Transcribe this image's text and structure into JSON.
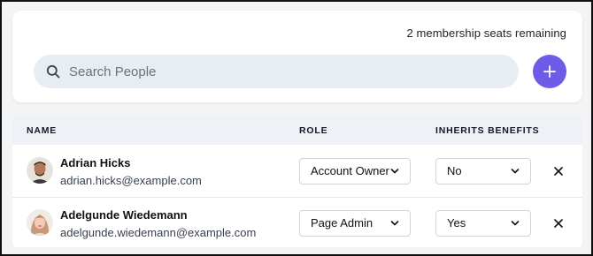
{
  "header": {
    "seats_text": "2 membership seats remaining"
  },
  "search": {
    "placeholder": "Search People",
    "value": ""
  },
  "add_button": {
    "icon": "plus-icon",
    "color": "#6d5ce7"
  },
  "table": {
    "columns": [
      "NAME",
      "ROLE",
      "INHERITS BENEFITS"
    ],
    "rows": [
      {
        "name": "Adrian Hicks",
        "email": "adrian.hicks@example.com",
        "role": "Account Owner",
        "inherits": "No"
      },
      {
        "name": "Adelgunde Wiedemann",
        "email": "adelgunde.wiedemann@example.com",
        "role": "Page Admin",
        "inherits": "Yes"
      }
    ]
  }
}
